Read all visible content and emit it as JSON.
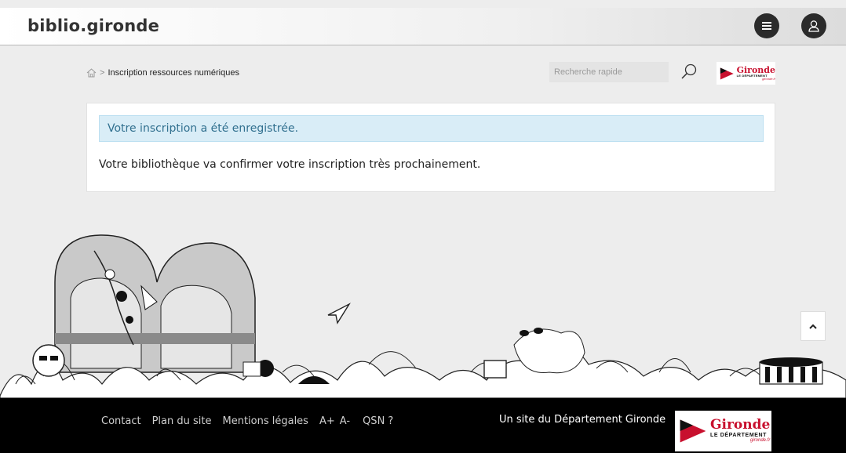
{
  "header": {
    "brand": "biblio.gironde",
    "menu_icon": "menu-icon",
    "user_icon": "user-icon"
  },
  "breadcrumb": {
    "home_icon": "home-icon",
    "separator": ">",
    "current": "Inscription ressources numériques"
  },
  "search": {
    "placeholder": "Recherche rapide",
    "icon": "search-icon"
  },
  "logo": {
    "name": "Gironde",
    "subtitle": "LE DÉPARTEMENT",
    "url_text": "gironde.fr"
  },
  "card": {
    "alert": "Votre inscription a été enregistrée.",
    "message": "Votre bibliothèque va confirmer votre inscription très prochainement."
  },
  "scroll_top_icon": "chevron-up-icon",
  "footer": {
    "links": [
      "Contact",
      "Plan du site",
      "Mentions légales"
    ],
    "font_increase": "A+",
    "font_decrease": "A-",
    "qsn": "QSN ?",
    "credit": "Un site du Département Gironde"
  },
  "colors": {
    "alert_bg": "#d9edf7",
    "alert_text": "#31708f",
    "logo_red": "#c8102e",
    "footer_bg": "#000000"
  }
}
